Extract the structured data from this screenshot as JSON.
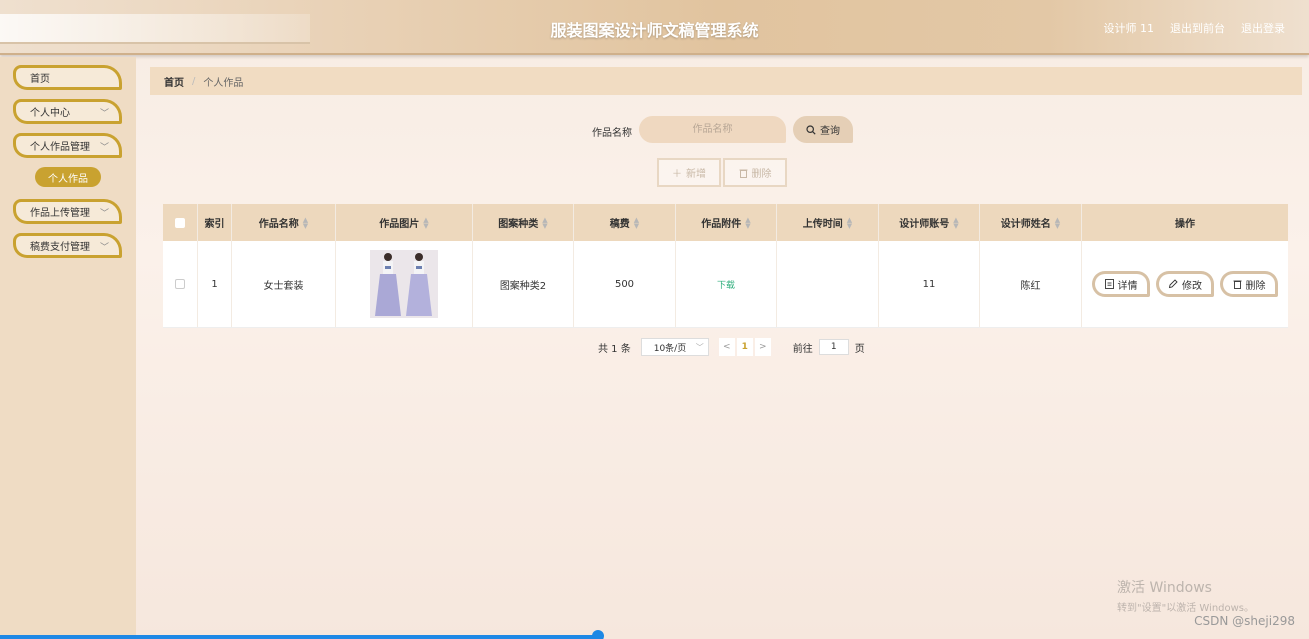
{
  "header": {
    "title": "服装图案设计师文稿管理系统",
    "user_label": "设计师 11",
    "back_front_label": "退出到前台",
    "logout_label": "退出登录"
  },
  "sidebar": {
    "items": [
      {
        "label": "首页"
      },
      {
        "label": "个人中心"
      },
      {
        "label": "个人作品管理"
      },
      {
        "label": "作品上传管理"
      },
      {
        "label": "稿费支付管理"
      }
    ],
    "sub_item": "个人作品"
  },
  "breadcrumb": {
    "home": "首页",
    "sep": "/",
    "current": "个人作品"
  },
  "search": {
    "label": "作品名称",
    "placeholder": "作品名称",
    "button_label": "查询"
  },
  "actions": {
    "add_label": "新增",
    "delete_label": "删除"
  },
  "table": {
    "columns": [
      "索引",
      "作品名称",
      "作品图片",
      "图案种类",
      "稿费",
      "作品附件",
      "上传时间",
      "设计师账号",
      "设计师姓名",
      "操作"
    ],
    "rows": [
      {
        "index": "1",
        "name": "女士套装",
        "category": "图案种类2",
        "fee": "500",
        "attachment": "下载",
        "upload_time": "",
        "account": "11",
        "designer": "陈红"
      }
    ],
    "row_actions": {
      "detail": "详情",
      "edit": "修改",
      "delete": "删除"
    }
  },
  "pagination": {
    "total": "共 1 条",
    "page_size": "10条/页",
    "current_page": "1",
    "goto_prefix": "前往",
    "goto_value": "1",
    "goto_suffix": "页"
  },
  "watermark": {
    "line1": "激活 Windows",
    "line2": "转到\"设置\"以激活 Windows。"
  },
  "credit": "CSDN @sheji298",
  "colors": {
    "accent": "#c9a230",
    "header": "#e1c49f",
    "table_header": "#edd8bd",
    "download": "#2fae7c"
  }
}
